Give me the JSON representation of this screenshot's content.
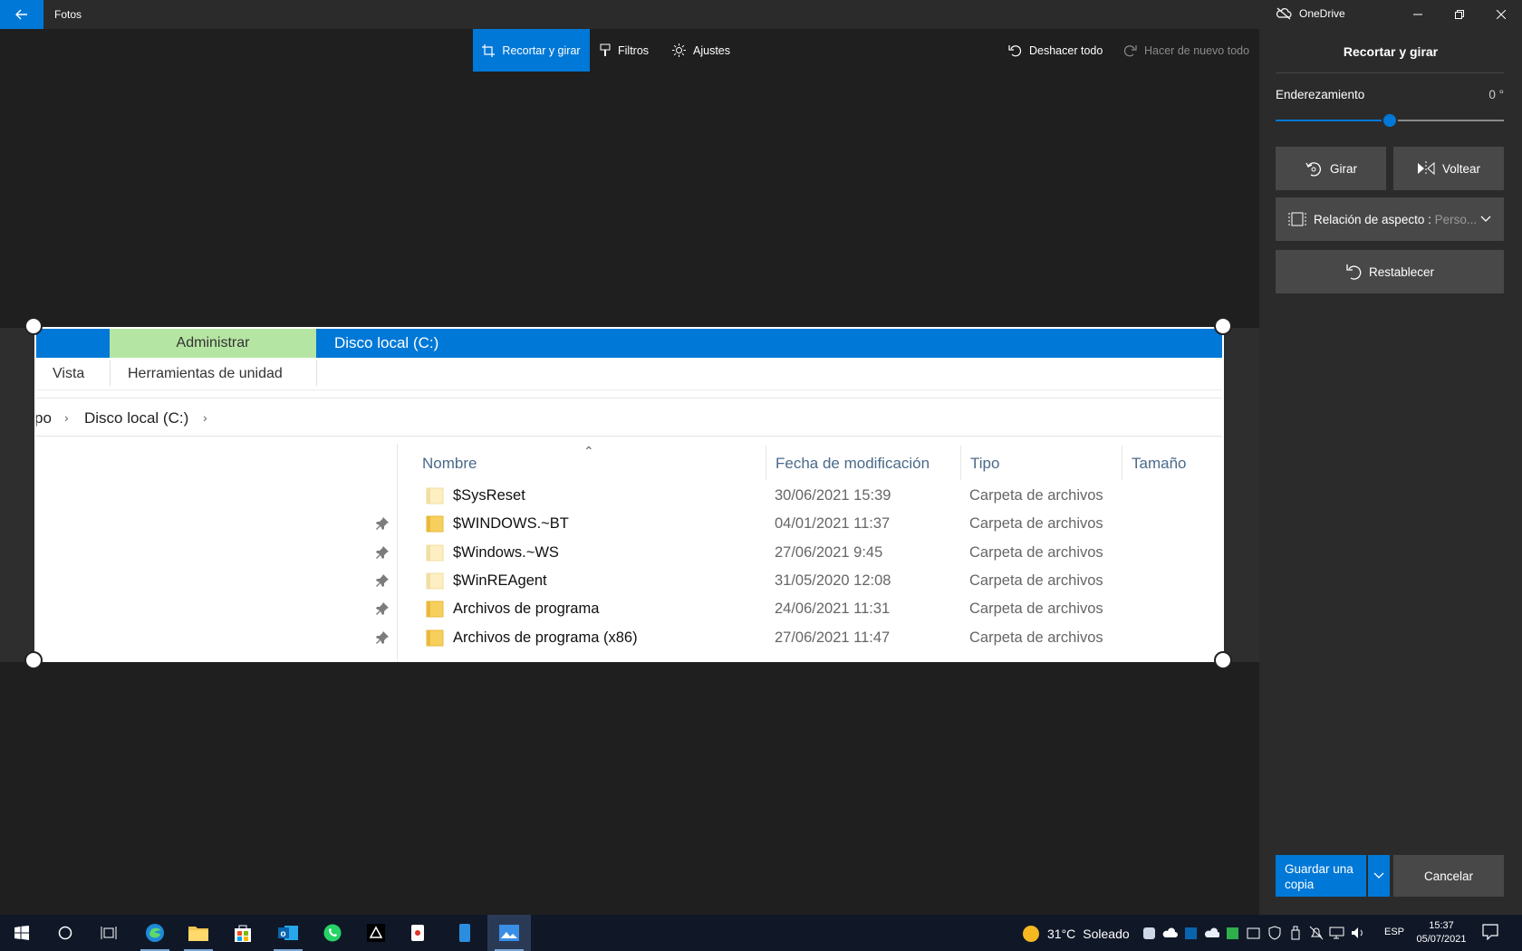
{
  "titlebar": {
    "app_title": "Fotos",
    "onedrive_label": "OneDrive"
  },
  "toolbar": {
    "crop_label": "Recortar y girar",
    "filters_label": "Filtros",
    "adjust_label": "Ajustes",
    "undo_all_label": "Deshacer todo",
    "redo_all_label": "Hacer de nuevo todo"
  },
  "photo": {
    "ribbon_admin": "Administrar",
    "ribbon_title": "Disco local (C:)",
    "tab_view": "Vista",
    "tab_drive_tools": "Herramientas de unidad",
    "breadcrumb_partial": "po",
    "breadcrumb_drive": "Disco local (C:)",
    "columns": {
      "name": "Nombre",
      "modified": "Fecha de modificación",
      "type": "Tipo",
      "size": "Tamaño"
    },
    "rows": [
      {
        "name": "$SysReset",
        "date": "30/06/2021 15:39",
        "type": "Carpeta de archivos",
        "pale": true
      },
      {
        "name": "$WINDOWS.~BT",
        "date": "04/01/2021 11:37",
        "type": "Carpeta de archivos",
        "pale": false
      },
      {
        "name": "$Windows.~WS",
        "date": "27/06/2021 9:45",
        "type": "Carpeta de archivos",
        "pale": true
      },
      {
        "name": "$WinREAgent",
        "date": "31/05/2020 12:08",
        "type": "Carpeta de archivos",
        "pale": true
      },
      {
        "name": "Archivos de programa",
        "date": "24/06/2021 11:31",
        "type": "Carpeta de archivos",
        "pale": false
      },
      {
        "name": "Archivos de programa (x86)",
        "date": "27/06/2021 11:47",
        "type": "Carpeta de archivos",
        "pale": false
      }
    ]
  },
  "panel": {
    "title": "Recortar y girar",
    "straighten_label": "Enderezamiento",
    "straighten_value": "0 °",
    "straighten_level": 0.5,
    "rotate_label": "Girar",
    "flip_label": "Voltear",
    "aspect_label": "Relación de aspecto : ",
    "aspect_value": "Perso...",
    "reset_label": "Restablecer",
    "save_copy_label": "Guardar una copia",
    "cancel_label": "Cancelar"
  },
  "taskbar": {
    "weather_temp": "31°C",
    "weather_text": "Soleado",
    "language": "ESP",
    "time": "15:37",
    "date": "05/07/2021"
  },
  "colors": {
    "accent": "#0078d7",
    "admin_tab": "#b5e5a3",
    "background": "#1f1f1f",
    "panel": "#2b2b2b"
  }
}
